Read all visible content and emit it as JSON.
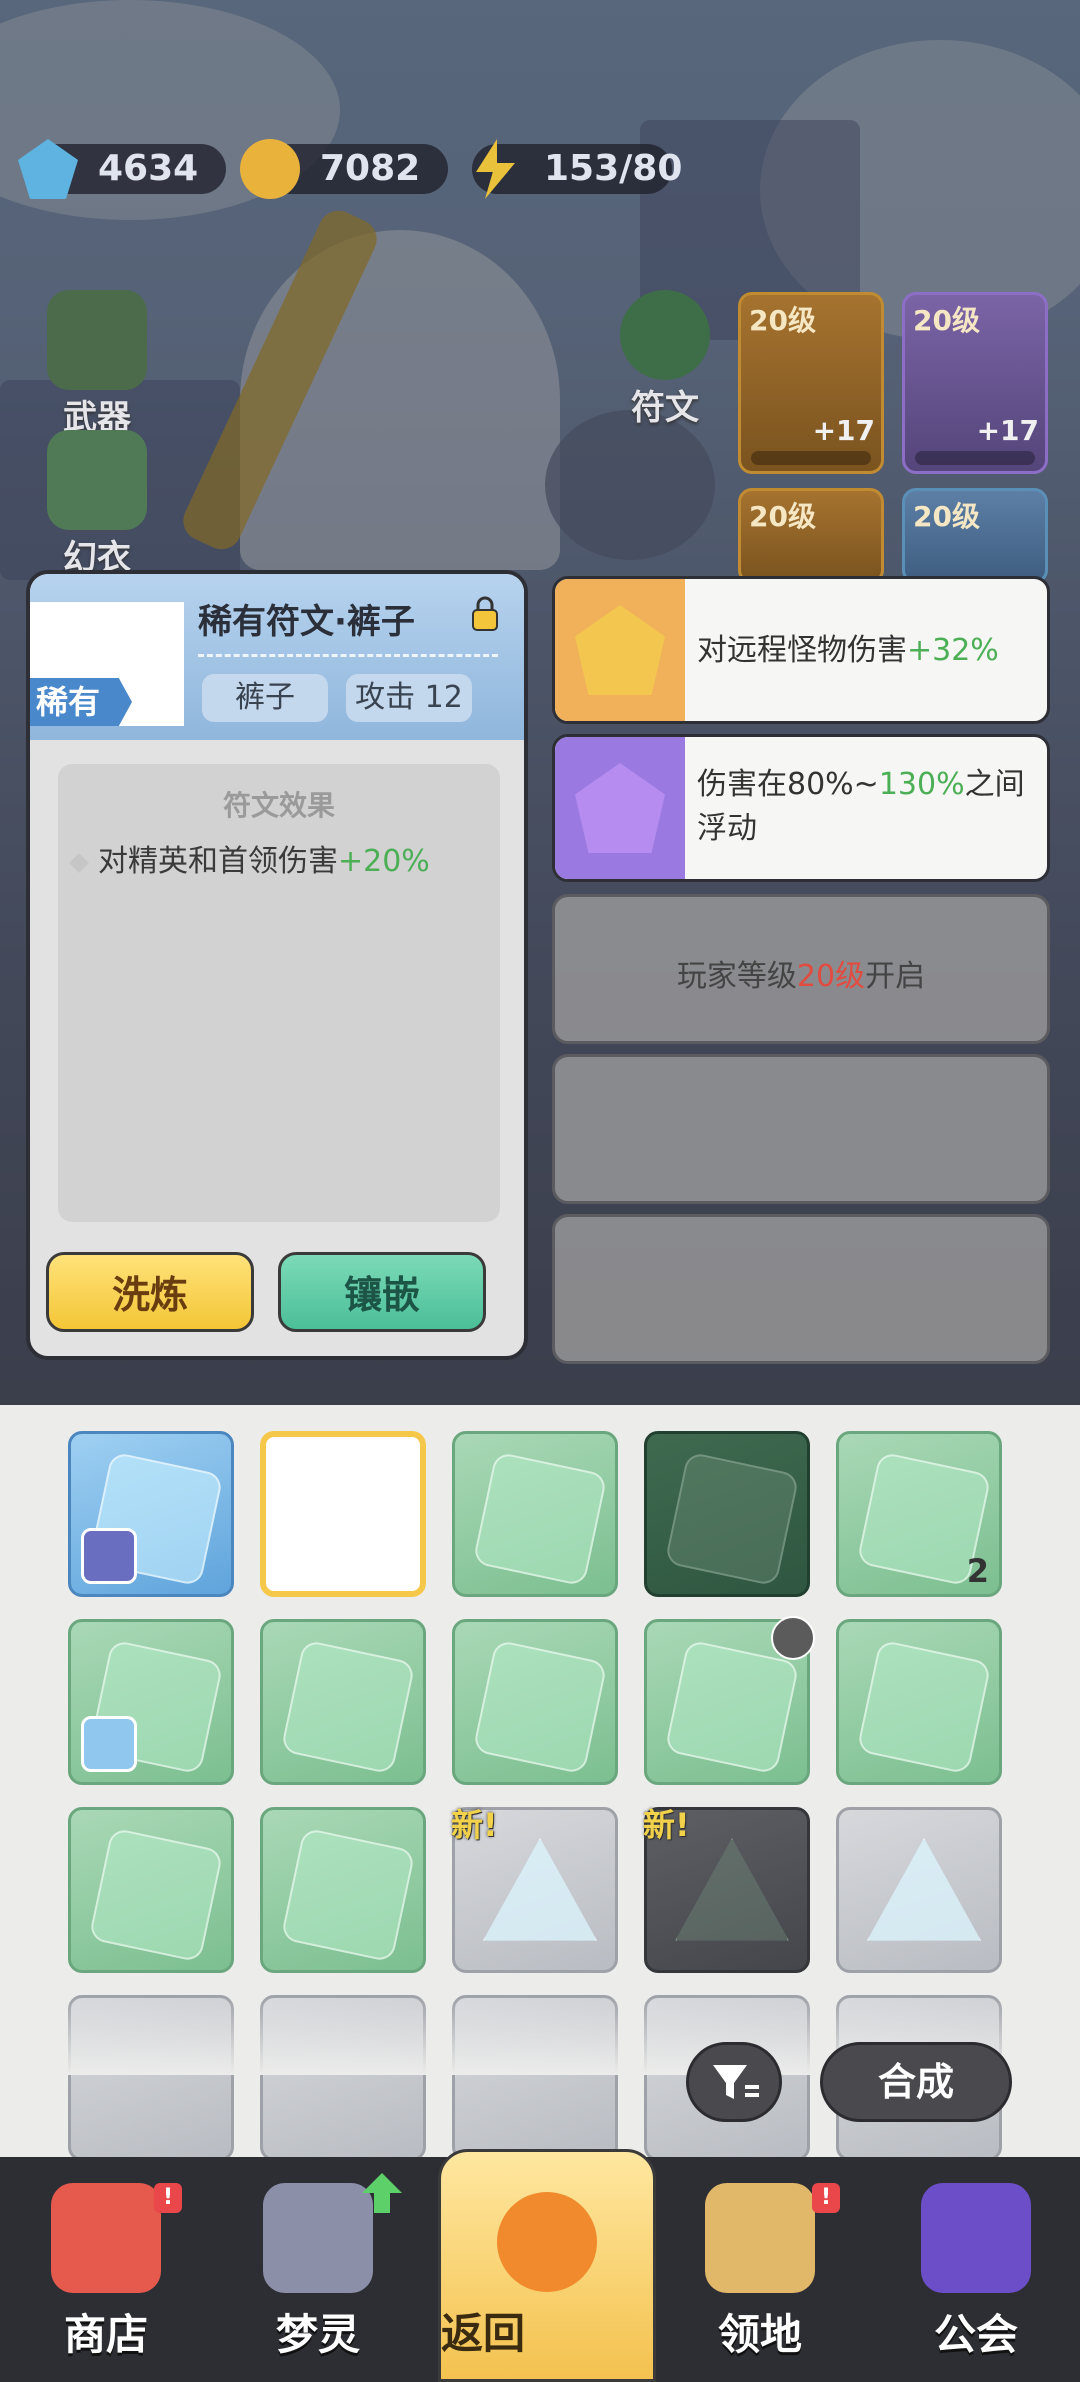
{
  "resources": {
    "gems": "4634",
    "gold": "7082",
    "energy": "153/80"
  },
  "side_menu": {
    "weapon": "武器",
    "costume": "幻衣",
    "rune": "符文"
  },
  "equipment": [
    {
      "level": "20级",
      "plus": "+17"
    },
    {
      "level": "20级",
      "plus": "+17"
    },
    {
      "level": "20级",
      "plus": ""
    },
    {
      "level": "20级",
      "plus": ""
    }
  ],
  "rune_panel": {
    "rarity": "稀有",
    "name": "稀有符文·裤子",
    "slot_type": "裤子",
    "stat": "攻击 12",
    "effect_title": "符文效果",
    "effect_text": "对精英和首领伤害",
    "effect_value": "+20%",
    "refine_label": "洗炼",
    "inlay_label": "镶嵌"
  },
  "effect_cards": [
    {
      "text": "对远程怪物伤害",
      "value": "+32%",
      "colors": {
        "strip": "#f0b15a",
        "gem": "#f3c64f"
      }
    },
    {
      "text_before": "伤害在80%~",
      "value": "130%",
      "text_after": "之间浮动",
      "colors": {
        "strip": "#9a7ae0",
        "gem": "#b68cf0"
      }
    },
    {
      "text_before": "玩家等级",
      "value": "20级",
      "text_after": "开启"
    }
  ],
  "inventory": {
    "new_tag": "新!",
    "count_label": "2",
    "merge_label": "合成"
  },
  "nav": {
    "shop": "商店",
    "spirit": "梦灵",
    "back": "返回",
    "territory": "领地",
    "guild": "公会",
    "alert_mark": "!"
  }
}
